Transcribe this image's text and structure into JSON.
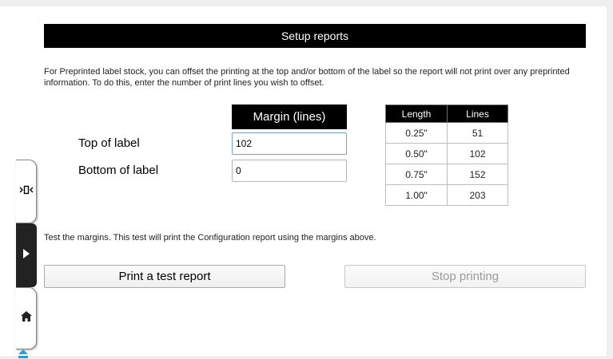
{
  "title": "Setup reports",
  "intro": "For Preprinted label stock, you can offset the printing at the top and/or bottom of the label so the report will not print over any preprinted information.  To do this, enter the number of print lines you wish to offset.",
  "margin_header": "Margin (lines)",
  "top_label": "Top of label",
  "top_value": "102",
  "bottom_label": "Bottom of label",
  "bottom_value": "0",
  "reference_table": {
    "headers": [
      "Length",
      "Lines"
    ],
    "rows": [
      [
        "0.25\"",
        "51"
      ],
      [
        "0.50\"",
        "102"
      ],
      [
        "0.75\"",
        "152"
      ],
      [
        "1.00\"",
        "203"
      ]
    ]
  },
  "test_description": "Test the margins.  This test will print the Configuration report using the margins above.",
  "print_test_button": "Print a test report",
  "stop_button": "Stop printing",
  "side_nav": {
    "icons": [
      "scale-icon",
      "play-icon",
      "home-icon",
      "eject-icon"
    ],
    "accent": "#2b9bd6"
  }
}
